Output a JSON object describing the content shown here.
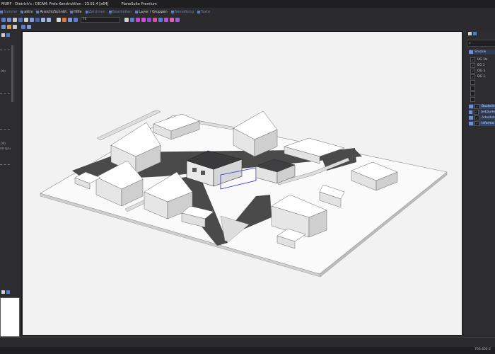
{
  "window": {
    "title": "MURF - Dietrich's : DICAM: Freie Konstruktion : 23.01.4 [x64]",
    "edition": "PlaneSuite Premium"
  },
  "menu": {
    "items": [
      {
        "label": "Summe",
        "dim": true
      },
      {
        "label": "aktiv",
        "dim": false
      },
      {
        "label": "Ansicht/Schnitt",
        "dim": false
      },
      {
        "label": "Hilfe",
        "dim": false
      },
      {
        "label": "Zeichnen",
        "dim": true
      },
      {
        "label": "Bearbeiten",
        "dim": true
      },
      {
        "label": "Layer / Gruppen",
        "dim": false
      },
      {
        "label": "Bemaßung",
        "dim": true
      },
      {
        "label": "Texte",
        "dim": true
      }
    ]
  },
  "toolbar": {
    "combo_value": "FE"
  },
  "left_panel": {
    "labels": [
      ".00)",
      ".00)",
      "ntergru"
    ]
  },
  "layers_panel": {
    "header": "Stockw",
    "floors": [
      {
        "label": "UG 1b",
        "checked": true
      },
      {
        "label": "EG 1",
        "checked": true
      },
      {
        "label": "OG 1",
        "checked": true
      },
      {
        "label": "DG 1",
        "checked": true
      },
      {
        "label": "",
        "checked": false
      },
      {
        "label": "",
        "checked": false
      },
      {
        "label": "",
        "checked": false
      },
      {
        "label": "",
        "checked": false
      }
    ],
    "folders": [
      {
        "label": "Bauteile",
        "highlight": true
      },
      {
        "label": "Gebäude",
        "highlight": false
      },
      {
        "label": "Arbeitsb",
        "highlight": false
      },
      {
        "label": "Informa",
        "highlight": true
      }
    ]
  },
  "status": {
    "coordinates": "763.452 E"
  },
  "colors": {
    "chrome_dark": "#2d2d30",
    "viewport_bg": "#f2f2f2",
    "accent_blue": "#4f7fdc",
    "road": "#4a4a4a"
  }
}
